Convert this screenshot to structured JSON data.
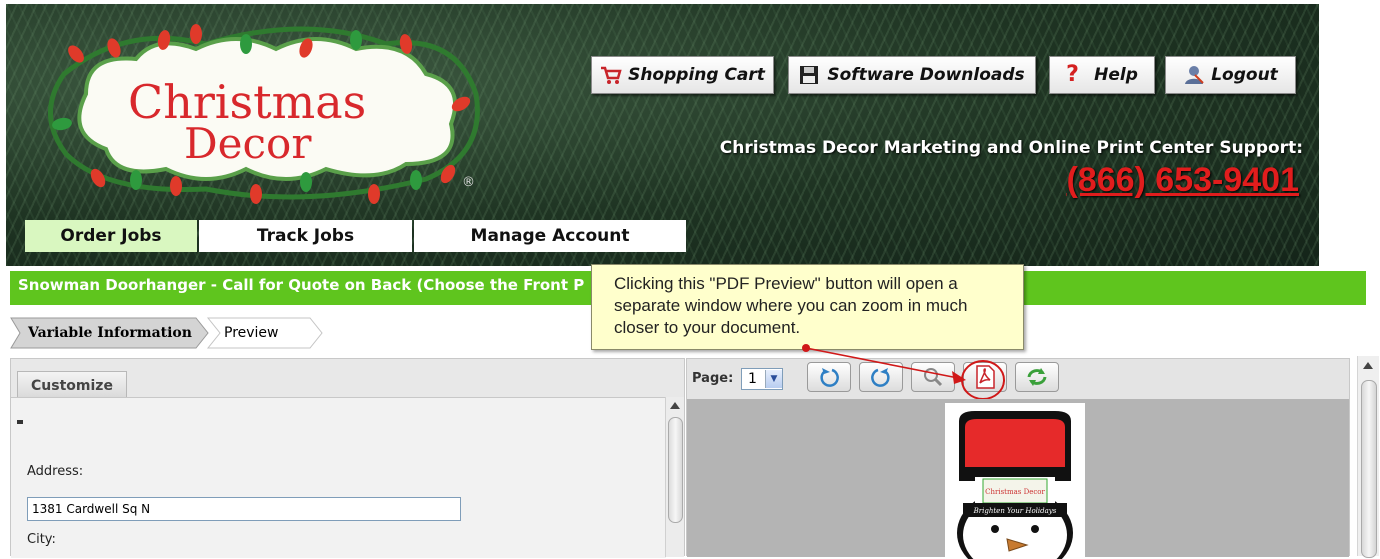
{
  "header": {
    "logo_line1": "Christmas",
    "logo_line2": "Decor",
    "logo_mark": "®",
    "buttons": [
      {
        "label": "Shopping Cart",
        "icon": "shopping-cart-icon"
      },
      {
        "label": "Software Downloads",
        "icon": "floppy-disk-icon"
      },
      {
        "label": "Help",
        "icon": "question-mark-icon"
      },
      {
        "label": "Logout",
        "icon": "user-logout-icon"
      }
    ],
    "support_label": "Christmas Decor Marketing and Online Print Center Support:",
    "support_phone": "(866) 653-9401"
  },
  "nav": {
    "tabs": [
      "Order Jobs",
      "Track Jobs",
      "Manage Account"
    ],
    "active_tab": "Order Jobs"
  },
  "title_bar": {
    "text": "Snowman Doorhanger - Call for Quote on Back (Choose the Front P"
  },
  "steps": {
    "variable_information": "Variable Information",
    "preview": "Preview"
  },
  "left_panel": {
    "tab_label": "Customize",
    "address_label": "Address:",
    "address_value": "1381 Cardwell Sq N",
    "city_label": "City:"
  },
  "right_panel": {
    "page_label": "Page:",
    "page_value": "1",
    "tools": [
      "rotate-left-icon",
      "rotate-right-icon",
      "zoom-icon",
      "pdf-icon",
      "refresh-icon"
    ],
    "preview_logo_text": "Christmas Decor",
    "preview_tagline": "Brighten Your Holidays"
  },
  "callout": {
    "text": "Clicking this \"PDF Preview\" button will open a separate window where you can zoom in much closer to your document."
  },
  "colors": {
    "green_bar": "#5fc51e",
    "phone_red": "#e11d1d",
    "active_tab": "#d9f7c0",
    "callout_bg": "#ffffcc",
    "hat_red": "#e62a2a"
  }
}
